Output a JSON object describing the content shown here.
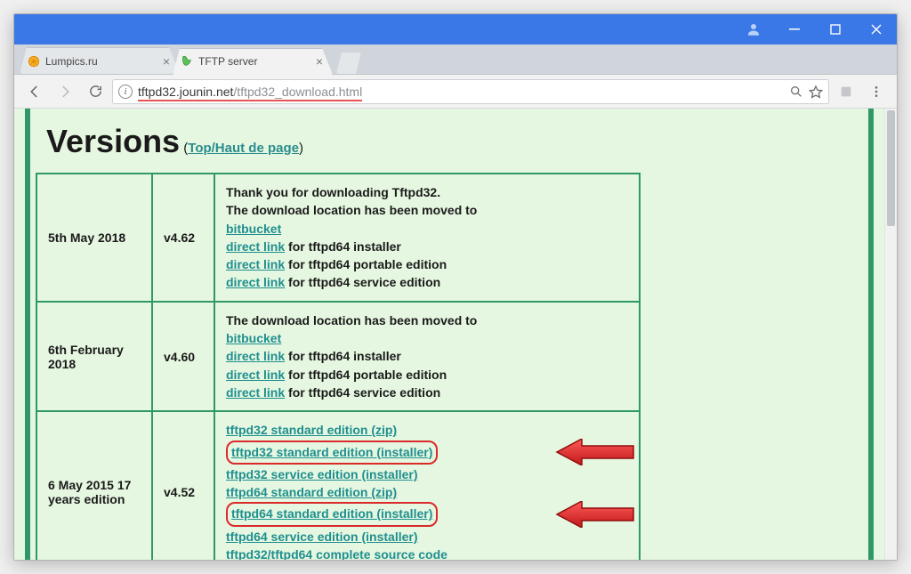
{
  "window": {
    "tabs": [
      {
        "title": "Lumpics.ru",
        "active": false
      },
      {
        "title": "TFTP server",
        "active": true
      }
    ],
    "url_host": "tftpd32.jounin.net",
    "url_path": "/tftpd32_download.html"
  },
  "page": {
    "heading": "Versions",
    "top_link": "Top/Haut de page",
    "rows": [
      {
        "date": "5th May 2018",
        "version": "v4.62",
        "intro": [
          "Thank you for downloading Tftpd32.",
          "The download location has been moved to"
        ],
        "links": [
          {
            "text": "bitbucket",
            "suffix": ""
          },
          {
            "text": "direct link",
            "suffix": " for tftpd64 installer"
          },
          {
            "text": "direct link",
            "suffix": " for tftpd64 portable edition"
          },
          {
            "text": "direct link",
            "suffix": " for tftpd64 service edition"
          }
        ]
      },
      {
        "date": "6th February 2018",
        "version": "v4.60",
        "intro": [
          "The download location has been moved to"
        ],
        "links": [
          {
            "text": "bitbucket",
            "suffix": ""
          },
          {
            "text": "direct link",
            "suffix": " for tftpd64 installer"
          },
          {
            "text": "direct link",
            "suffix": " for tftpd64 portable edition"
          },
          {
            "text": "direct link",
            "suffix": " for tftpd64 service edition"
          }
        ]
      },
      {
        "date": "6 May 2015 17 years edition",
        "version": "v4.52",
        "intro": [],
        "links": [
          {
            "text": "tftpd32 standard edition (zip)",
            "highlight": false
          },
          {
            "text": "tftpd32 standard edition (installer)",
            "highlight": true
          },
          {
            "text": "tftpd32 service edition (installer)",
            "highlight": false
          },
          {
            "text": "tftpd64 standard edition (zip)",
            "highlight": false
          },
          {
            "text": "tftpd64 standard edition (installer)",
            "highlight": true
          },
          {
            "text": "tftpd64 service edition (installer)",
            "highlight": false
          },
          {
            "text": "tftpd32/tftpd64 complete source code",
            "highlight": false
          }
        ]
      }
    ]
  }
}
